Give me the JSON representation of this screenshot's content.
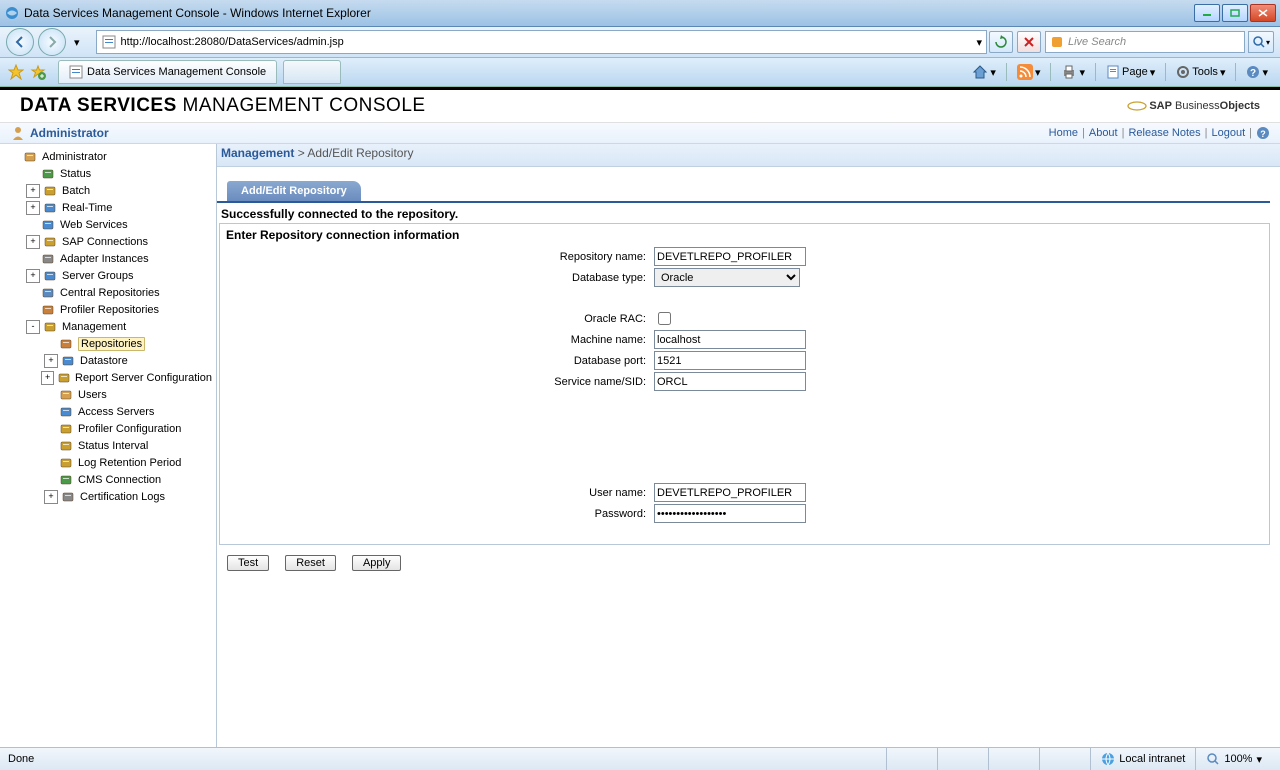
{
  "window": {
    "title": "Data Services Management Console - Windows Internet Explorer"
  },
  "navbar": {
    "url": "http://localhost:28080/DataServices/admin.jsp",
    "search_placeholder": "Live Search"
  },
  "tabbar": {
    "tab_title": "Data Services Management Console",
    "page_label": "Page",
    "tools_label": "Tools"
  },
  "console": {
    "title_strong": "DATA SERVICES",
    "title_rest": "MANAGEMENT CONSOLE",
    "logo_text": "SAP BusinessObjects"
  },
  "adminbar": {
    "label": "Administrator",
    "links": {
      "home": "Home",
      "about": "About",
      "release_notes": "Release Notes",
      "logout": "Logout"
    }
  },
  "breadcrumb": {
    "root": "Management",
    "sep": ">",
    "current": "Add/Edit Repository"
  },
  "content_tab": "Add/Edit Repository",
  "status_msg": "Successfully connected to the repository.",
  "form": {
    "title": "Enter Repository connection information",
    "labels": {
      "repo_name": "Repository name:",
      "db_type": "Database type:",
      "oracle_rac": "Oracle RAC:",
      "machine": "Machine name:",
      "db_port": "Database port:",
      "service_sid": "Service name/SID:",
      "user": "User name:",
      "password": "Password:"
    },
    "values": {
      "repo_name": "DEVETLREPO_PROFILER",
      "db_type": "Oracle",
      "oracle_rac": false,
      "machine": "localhost",
      "db_port": "1521",
      "service_sid": "ORCL",
      "user": "DEVETLREPO_PROFILER",
      "password": "••••••••••••••••••"
    }
  },
  "buttons": {
    "test": "Test",
    "reset": "Reset",
    "apply": "Apply"
  },
  "tree": [
    {
      "lvl": 0,
      "exp": "",
      "ic": "admin",
      "label": "Administrator"
    },
    {
      "lvl": 1,
      "exp": "",
      "ic": "status",
      "label": "Status"
    },
    {
      "lvl": 1,
      "exp": "+",
      "ic": "batch",
      "label": "Batch"
    },
    {
      "lvl": 1,
      "exp": "+",
      "ic": "rt",
      "label": "Real-Time"
    },
    {
      "lvl": 1,
      "exp": "",
      "ic": "ws",
      "label": "Web Services"
    },
    {
      "lvl": 1,
      "exp": "+",
      "ic": "sap",
      "label": "SAP Connections"
    },
    {
      "lvl": 1,
      "exp": "",
      "ic": "adapter",
      "label": "Adapter Instances"
    },
    {
      "lvl": 1,
      "exp": "+",
      "ic": "sg",
      "label": "Server Groups"
    },
    {
      "lvl": 1,
      "exp": "",
      "ic": "cr",
      "label": "Central Repositories"
    },
    {
      "lvl": 1,
      "exp": "",
      "ic": "pr",
      "label": "Profiler Repositories"
    },
    {
      "lvl": 1,
      "exp": "-",
      "ic": "mgmt",
      "label": "Management"
    },
    {
      "lvl": 2,
      "exp": "",
      "ic": "repo",
      "label": "Repositories",
      "sel": true
    },
    {
      "lvl": 2,
      "exp": "+",
      "ic": "ds",
      "label": "Datastore"
    },
    {
      "lvl": 2,
      "exp": "+",
      "ic": "rsc",
      "label": "Report Server Configuration"
    },
    {
      "lvl": 2,
      "exp": "",
      "ic": "users",
      "label": "Users"
    },
    {
      "lvl": 2,
      "exp": "",
      "ic": "as",
      "label": "Access Servers"
    },
    {
      "lvl": 2,
      "exp": "",
      "ic": "pc",
      "label": "Profiler Configuration"
    },
    {
      "lvl": 2,
      "exp": "",
      "ic": "si",
      "label": "Status Interval"
    },
    {
      "lvl": 2,
      "exp": "",
      "ic": "lrp",
      "label": "Log Retention Period"
    },
    {
      "lvl": 2,
      "exp": "",
      "ic": "cms",
      "label": "CMS Connection"
    },
    {
      "lvl": 2,
      "exp": "+",
      "ic": "cl",
      "label": "Certification Logs"
    }
  ],
  "statusbar": {
    "done": "Done",
    "zone": "Local intranet",
    "zoom": "100%"
  }
}
